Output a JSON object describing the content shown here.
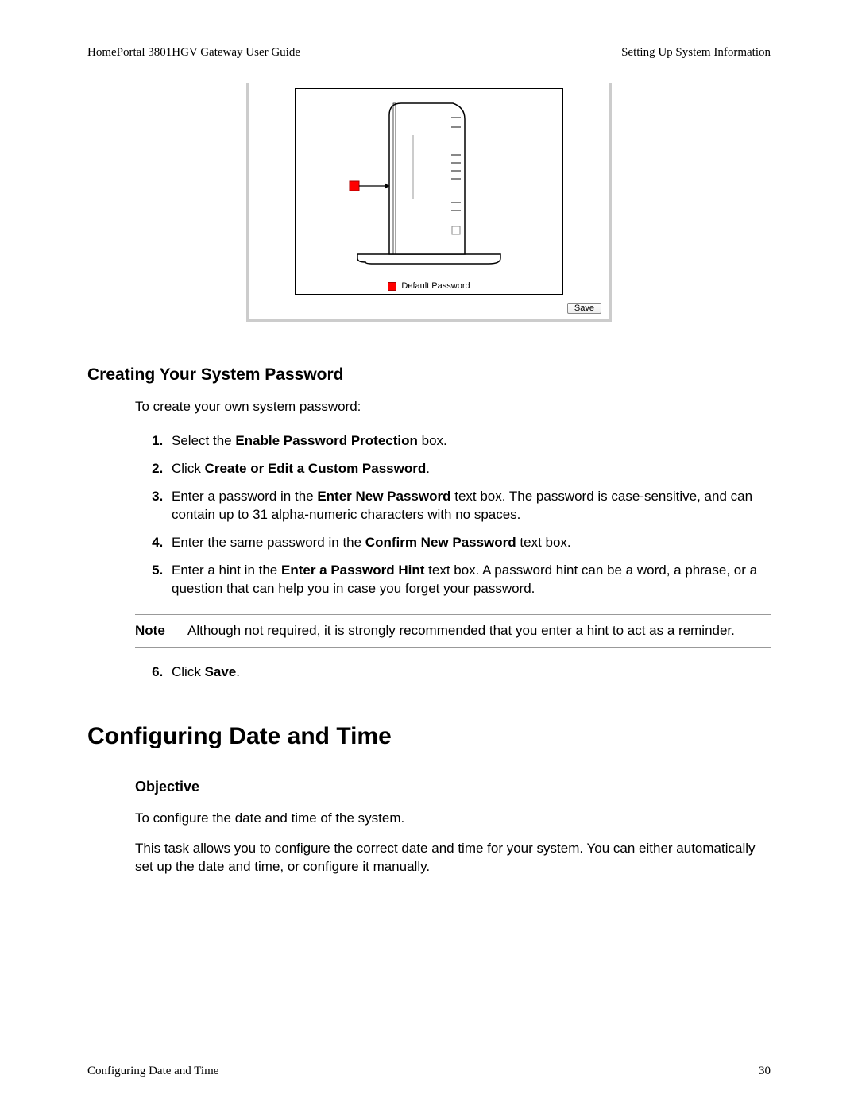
{
  "header": {
    "left": "HomePortal 3801HGV Gateway User Guide",
    "right": "Setting Up System Information"
  },
  "figure": {
    "legend_label": "Default Password",
    "save_button": "Save"
  },
  "section1": {
    "heading": "Creating Your System Password",
    "intro": "To create your own system password:",
    "steps": {
      "s1_a": "Select the ",
      "s1_b": "Enable Password Protection",
      "s1_c": " box.",
      "s2_a": "Click ",
      "s2_b": "Create or Edit a Custom Password",
      "s2_c": ".",
      "s3_a": "Enter a password in the ",
      "s3_b": "Enter New Password",
      "s3_c": " text box. The password is case-sensitive, and can contain up to 31 alpha-numeric characters with no spaces.",
      "s4_a": "Enter the same password in the ",
      "s4_b": "Confirm New Password",
      "s4_c": " text box.",
      "s5_a": "Enter a hint in the ",
      "s5_b": "Enter a Password Hint",
      "s5_c": " text box. A password hint can be a word, a phrase, or a question that can help you in case you forget your password.",
      "s6_a": "Click ",
      "s6_b": "Save",
      "s6_c": "."
    },
    "note_label": "Note",
    "note_text": "Although not required, it is strongly recommended that you enter a hint to act as a reminder."
  },
  "topic2": {
    "heading": "Configuring Date and Time",
    "sub": "Objective",
    "p1": "To configure the date and time of the system.",
    "p2": "This task allows you to configure the correct date and time for your system. You can either automatically set up the date and time, or configure it manually."
  },
  "footer": {
    "left": "Configuring Date and Time",
    "right": "30"
  }
}
